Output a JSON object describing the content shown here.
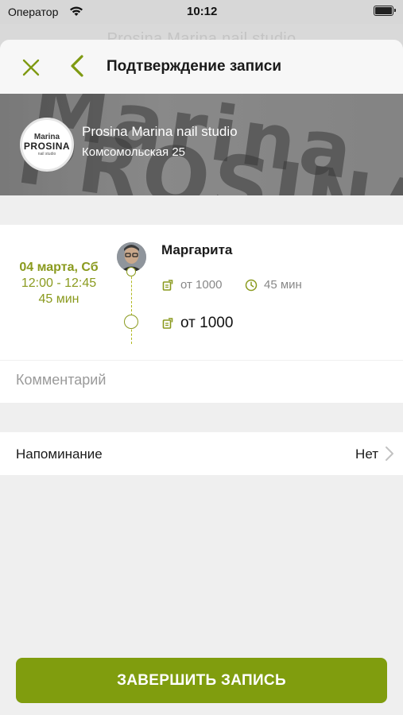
{
  "status_bar": {
    "carrier": "Оператор",
    "time": "10:12"
  },
  "background_title": "Prosina Marina nail studio",
  "header": {
    "title": "Подтверждение записи",
    "close_icon": "close-icon",
    "back_icon": "chevron-left-icon"
  },
  "studio": {
    "name": "Prosina Marina nail studio",
    "address": "Комсомольская 25",
    "logo": {
      "top": "Marina",
      "main": "PROSINA",
      "sub": "nail studio"
    }
  },
  "booking": {
    "date": "04 марта, Сб",
    "time_range": "12:00 - 12:45",
    "duration": "45 мин",
    "master": "Маргарита",
    "service_price": "от 1000",
    "service_duration": "45 мин",
    "total_price": "от 1000"
  },
  "comment": {
    "placeholder": "Комментарий",
    "value": ""
  },
  "reminder": {
    "label": "Напоминание",
    "value": "Нет"
  },
  "submit_label": "ЗАВЕРШИТЬ ЗАПИСЬ",
  "colors": {
    "accent": "#809d0e",
    "accent_text": "#8a9a1e",
    "background": "#efefef"
  }
}
